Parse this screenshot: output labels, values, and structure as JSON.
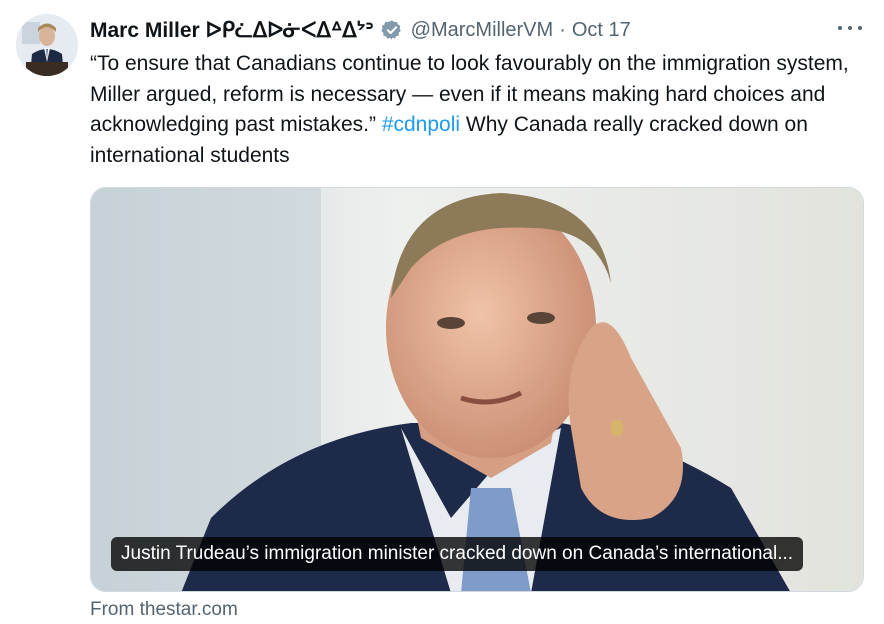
{
  "tweet": {
    "author_name": "Marc Miller ᐅᑭᓛᐃᐅᓃᐸᐃᐞᐃᔾᐣ",
    "handle": "@MarcMillerVM",
    "separator": "·",
    "date": "Oct 17",
    "text_main": "“To ensure that Canadians continue to look favourably on the immigration system, Miller argued, reform is necessary — even if it means making hard choices and acknowledging past mistakes.” ",
    "hashtag": "#cdnpoli",
    "text_tail": " Why Canada really cracked down on international students"
  },
  "card": {
    "caption": "Justin Trudeau’s immigration minister cracked down on Canada’s international...",
    "source": "From thestar.com"
  },
  "icons": {
    "verified": "verified-badge-icon",
    "more": "more-options-icon"
  },
  "colors": {
    "link": "#1d9bf0",
    "secondary_text": "#536471",
    "primary_text": "#0f1419"
  }
}
